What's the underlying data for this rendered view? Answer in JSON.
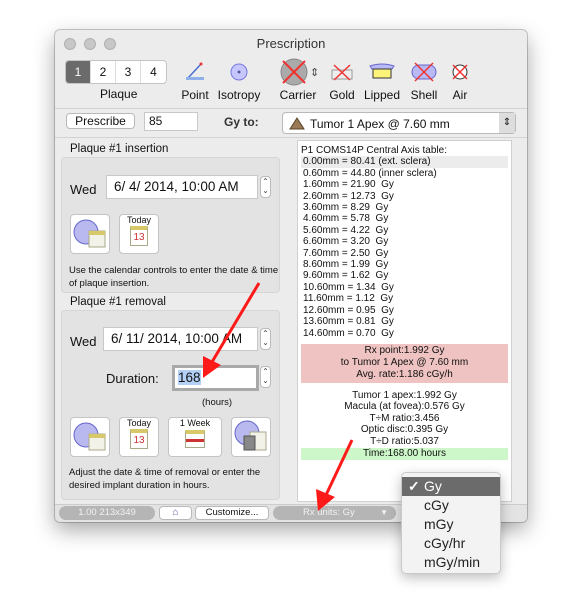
{
  "window": {
    "title": "Prescription"
  },
  "toolbar": {
    "plaque_tabs": [
      "1",
      "2",
      "3",
      "4"
    ],
    "plaque_selected": "1",
    "plaque_label": "Plaque",
    "tools": [
      {
        "label": "Point",
        "icon": "point-icon"
      },
      {
        "label": "Isotropy",
        "icon": "isotropy-icon"
      },
      {
        "label": "Carrier",
        "icon": "carrier-icon"
      },
      {
        "label": "Gold",
        "icon": "gold-icon"
      },
      {
        "label": "Lipped",
        "icon": "lipped-icon"
      },
      {
        "label": "Shell",
        "icon": "shell-icon"
      },
      {
        "label": "Air",
        "icon": "air-icon"
      }
    ]
  },
  "prescribe": {
    "button": "Prescribe",
    "value": "85",
    "gy_to_label": "Gy to:",
    "target": "Tumor 1 Apex @ 7.60 mm"
  },
  "insertion": {
    "title": "Plaque #1 insertion",
    "day": "Wed",
    "datetime": "6/  4/ 2014, 10:00 AM",
    "today_label": "Today",
    "today_day": "13",
    "note": "Use the calendar controls to enter the date & time of plaque insertion."
  },
  "removal": {
    "title": "Plaque #1 removal",
    "day": "Wed",
    "datetime": "6/ 11/ 2014, 10:00 AM",
    "duration_label": "Duration:",
    "duration": "168",
    "hours_label": "(hours)",
    "today_label": "Today",
    "today_day": "13",
    "week_label": "1 Week",
    "note": "Adjust the date & time of removal or enter the desired implant duration in hours."
  },
  "table": {
    "header": "P1 COMS14P Central Axis table:",
    "rows": [
      "0.00mm = 80.41 (ext. sclera)",
      "0.60mm = 44.80 (inner sclera)",
      "1.60mm = 21.90  Gy",
      "2.60mm = 12.73  Gy",
      "3.60mm = 8.29  Gy",
      "4.60mm = 5.78  Gy",
      "5.60mm = 4.22  Gy",
      "6.60mm = 3.20  Gy",
      "7.60mm = 2.50  Gy",
      "8.60mm = 1.99  Gy",
      "9.60mm = 1.62  Gy",
      "10.60mm = 1.34  Gy",
      "11.60mm = 1.12  Gy",
      "12.60mm = 0.95  Gy",
      "13.60mm = 0.81  Gy",
      "14.60mm = 0.70  Gy"
    ]
  },
  "rx_box": [
    "Rx point:1.992 Gy",
    "to Tumor 1 Apex @ 7.60 mm",
    "Avg. rate:1.186 cGy/h"
  ],
  "summary": [
    "Tumor 1 apex:1.992 Gy",
    "Macula (at fovea):0.576 Gy",
    "T÷M ratio:3.456",
    "Optic disc:0.395 Gy",
    "T÷D ratio:5.037"
  ],
  "time": "Time:168.00 hours",
  "statusbar": {
    "zoom": "1.00 213x349",
    "customize": "Customize...",
    "rx_units": "Rx units: Gy"
  },
  "units_menu": {
    "options": [
      "Gy",
      "cGy",
      "mGy",
      "cGy/hr",
      "mGy/min"
    ],
    "selected": "Gy"
  },
  "colors": {
    "rx_box": "#eec3c1",
    "time_box": "#cdf7c9",
    "annotation_arrow": "#ff0000",
    "selected": "#6b6b6b"
  }
}
